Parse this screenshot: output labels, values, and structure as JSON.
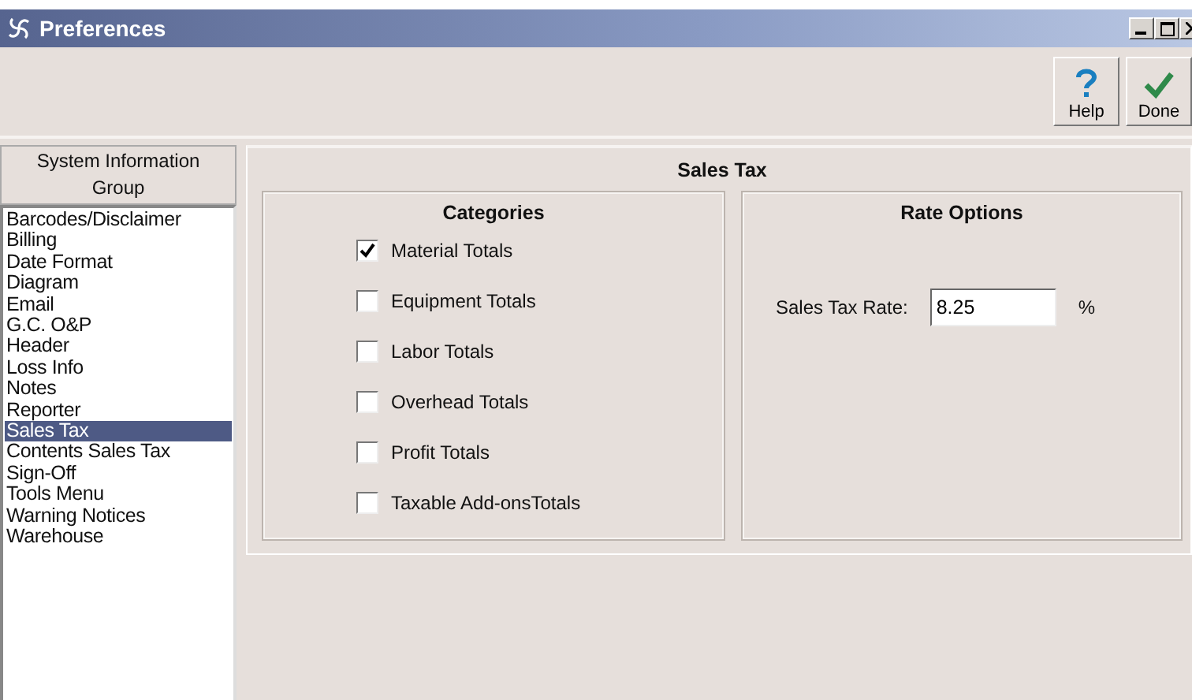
{
  "window": {
    "title": "Preferences"
  },
  "toolbar": {
    "buttons": [
      {
        "label": "Help",
        "kind": "help"
      },
      {
        "label": "Done",
        "kind": "done"
      }
    ]
  },
  "sidebar": {
    "header": "System Information Group",
    "items": [
      {
        "label": "Barcodes/Disclaimer",
        "selected": false
      },
      {
        "label": "Billing",
        "selected": false
      },
      {
        "label": "Date Format",
        "selected": false
      },
      {
        "label": "Diagram",
        "selected": false
      },
      {
        "label": "Email",
        "selected": false
      },
      {
        "label": "G.C. O&P",
        "selected": false
      },
      {
        "label": "Header",
        "selected": false
      },
      {
        "label": "Loss Info",
        "selected": false
      },
      {
        "label": "Notes",
        "selected": false
      },
      {
        "label": "Reporter",
        "selected": false
      },
      {
        "label": "Sales Tax",
        "selected": true
      },
      {
        "label": "Contents Sales Tax",
        "selected": false
      },
      {
        "label": "Sign-Off",
        "selected": false
      },
      {
        "label": "Tools Menu",
        "selected": false
      },
      {
        "label": "Warning Notices",
        "selected": false
      },
      {
        "label": "Warehouse",
        "selected": false
      }
    ]
  },
  "panel": {
    "title": "Sales Tax",
    "categories": {
      "title": "Categories",
      "items": [
        {
          "label": "Material Totals",
          "checked": true
        },
        {
          "label": "Equipment Totals",
          "checked": false
        },
        {
          "label": "Labor Totals",
          "checked": false
        },
        {
          "label": "Overhead Totals",
          "checked": false
        },
        {
          "label": "Profit Totals",
          "checked": false
        },
        {
          "label": "Taxable Add-onsTotals",
          "checked": false
        }
      ]
    },
    "rate_options": {
      "title": "Rate Options",
      "label": "Sales Tax Rate:",
      "value": "8.25",
      "unit": "%"
    }
  }
}
